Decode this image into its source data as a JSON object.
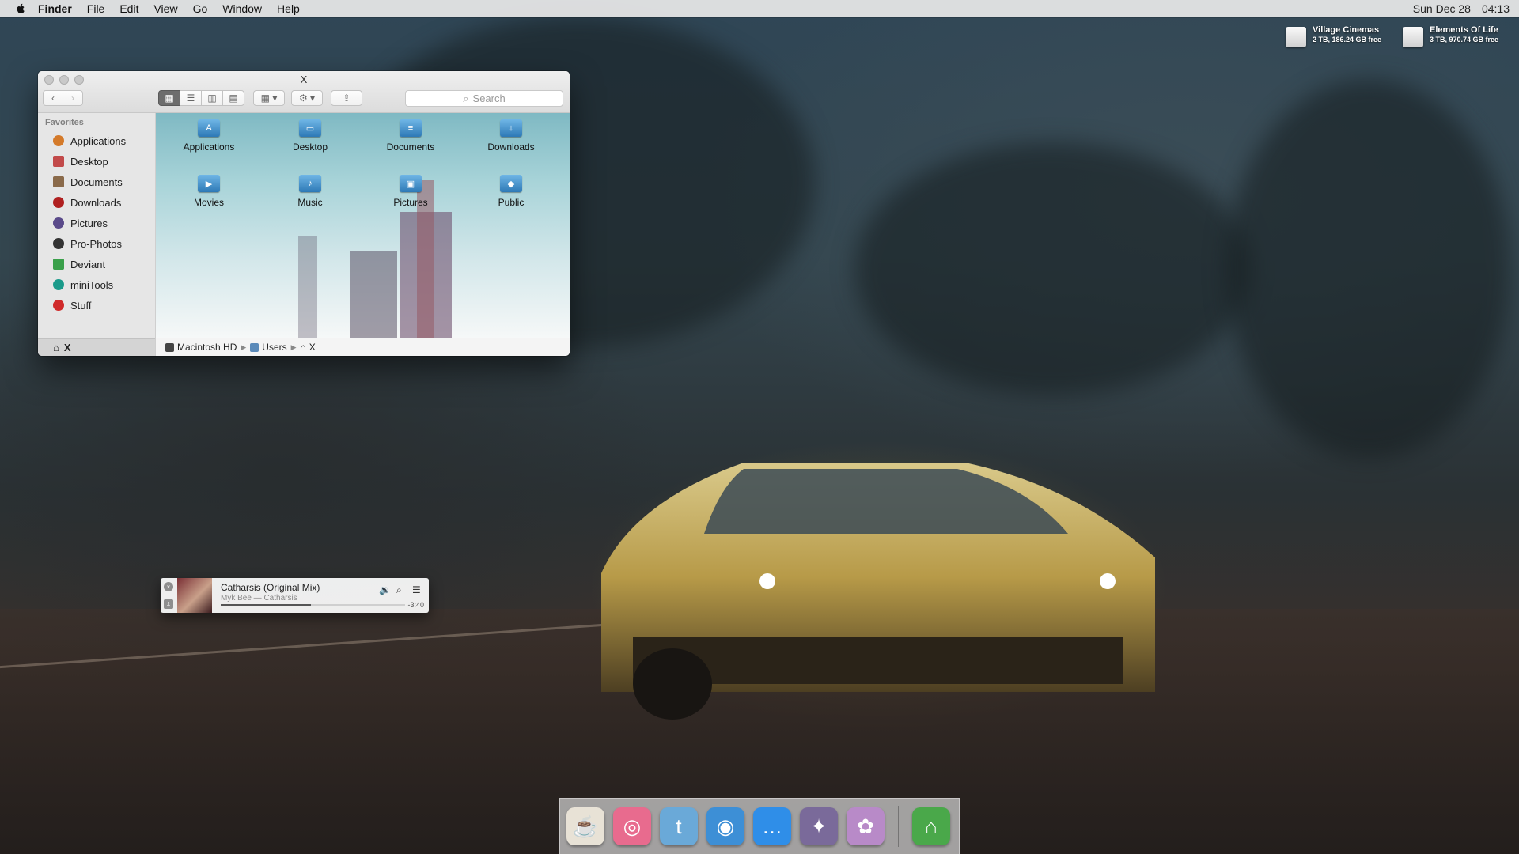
{
  "menubar": {
    "apple_icon": "apple-logo-icon",
    "items": [
      "Finder",
      "File",
      "Edit",
      "View",
      "Go",
      "Window",
      "Help"
    ],
    "date": "Sun Dec 28",
    "time": "04:13"
  },
  "drives": [
    {
      "name": "Village Cinemas",
      "info": "2 TB, 186.24 GB free"
    },
    {
      "name": "Elements Of Life",
      "info": "3 TB, 970.74 GB free"
    }
  ],
  "finder": {
    "title": "X",
    "search_placeholder": "Search",
    "sidebar_header": "Favorites",
    "sidebar_items": [
      {
        "label": "Applications",
        "color": "#d47a2a"
      },
      {
        "label": "Desktop",
        "color": "#c24a4a"
      },
      {
        "label": "Documents",
        "color": "#8a6a4a"
      },
      {
        "label": "Downloads",
        "color": "#b02020"
      },
      {
        "label": "Pictures",
        "color": "#5a4a8a"
      },
      {
        "label": "Pro-Photos",
        "color": "#333333"
      },
      {
        "label": "Deviant",
        "color": "#3aa04a"
      },
      {
        "label": "miniTools",
        "color": "#1a9a8a"
      },
      {
        "label": "Stuff",
        "color": "#d02a2a"
      }
    ],
    "sidebar_footer": "X",
    "folders": [
      {
        "label": "Applications",
        "icon": "applications-folder-icon",
        "glyph": "A"
      },
      {
        "label": "Desktop",
        "icon": "desktop-folder-icon",
        "glyph": "▭"
      },
      {
        "label": "Documents",
        "icon": "documents-folder-icon",
        "glyph": "≡"
      },
      {
        "label": "Downloads",
        "icon": "downloads-folder-icon",
        "glyph": "↓"
      },
      {
        "label": "Movies",
        "icon": "movies-folder-icon",
        "glyph": "▶"
      },
      {
        "label": "Music",
        "icon": "music-folder-icon",
        "glyph": "♪"
      },
      {
        "label": "Pictures",
        "icon": "pictures-folder-icon",
        "glyph": "▣"
      },
      {
        "label": "Public",
        "icon": "public-folder-icon",
        "glyph": "◆"
      }
    ],
    "path": [
      "Macintosh HD",
      "Users",
      "X"
    ]
  },
  "player": {
    "track": "Catharsis (Original Mix)",
    "artist_album": "Myk Bee — Catharsis",
    "remaining": "-3:40",
    "progress": 0.49
  },
  "dock": [
    {
      "name": "coffee-app-icon",
      "glyph": "☕",
      "color": "#e8e2d6"
    },
    {
      "name": "donut-app-icon",
      "glyph": "◎",
      "color": "#e86b8e"
    },
    {
      "name": "notes-jar-app-icon",
      "glyph": "t",
      "color": "#6aa9d8"
    },
    {
      "name": "music-player-app-icon",
      "glyph": "◉",
      "color": "#3d8fd6"
    },
    {
      "name": "messages-app-icon",
      "glyph": "…",
      "color": "#2f8ee8"
    },
    {
      "name": "preview-photos-app-icon",
      "glyph": "✦",
      "color": "#7a6a9a"
    },
    {
      "name": "cupcake-app-icon",
      "glyph": "✿",
      "color": "#b88ac8"
    },
    {
      "name": "trash-icon",
      "glyph": "⌂",
      "color": "#4aa84a"
    }
  ]
}
